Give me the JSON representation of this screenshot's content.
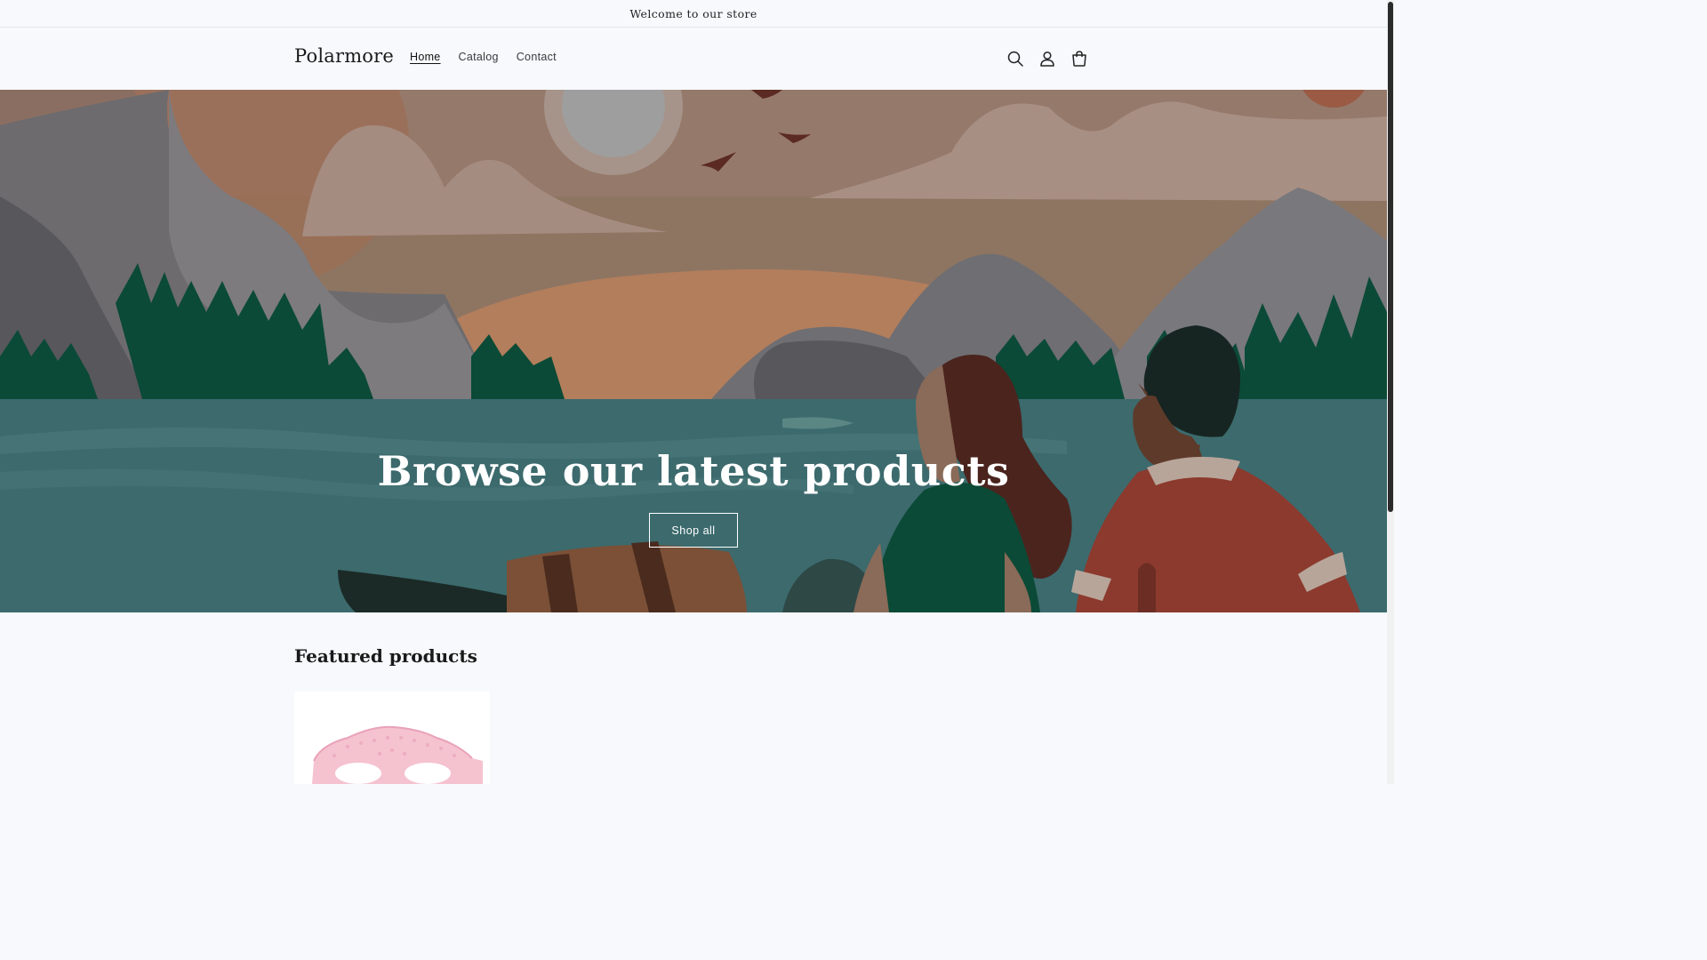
{
  "announcement": {
    "text": "Welcome to our store"
  },
  "header": {
    "logo": "Polarmore",
    "nav": [
      {
        "label": "Home",
        "active": true
      },
      {
        "label": "Catalog",
        "active": false
      },
      {
        "label": "Contact",
        "active": false
      }
    ],
    "icons": [
      "search-icon",
      "account-icon",
      "cart-icon"
    ]
  },
  "hero": {
    "title": "Browse our latest products",
    "button_label": "Shop all"
  },
  "featured": {
    "heading": "Featured products"
  },
  "colors": {
    "background": "#f7f9fc",
    "sky": "#8e7562",
    "water": "#3c6a6d",
    "forest": "#0b4a36"
  }
}
